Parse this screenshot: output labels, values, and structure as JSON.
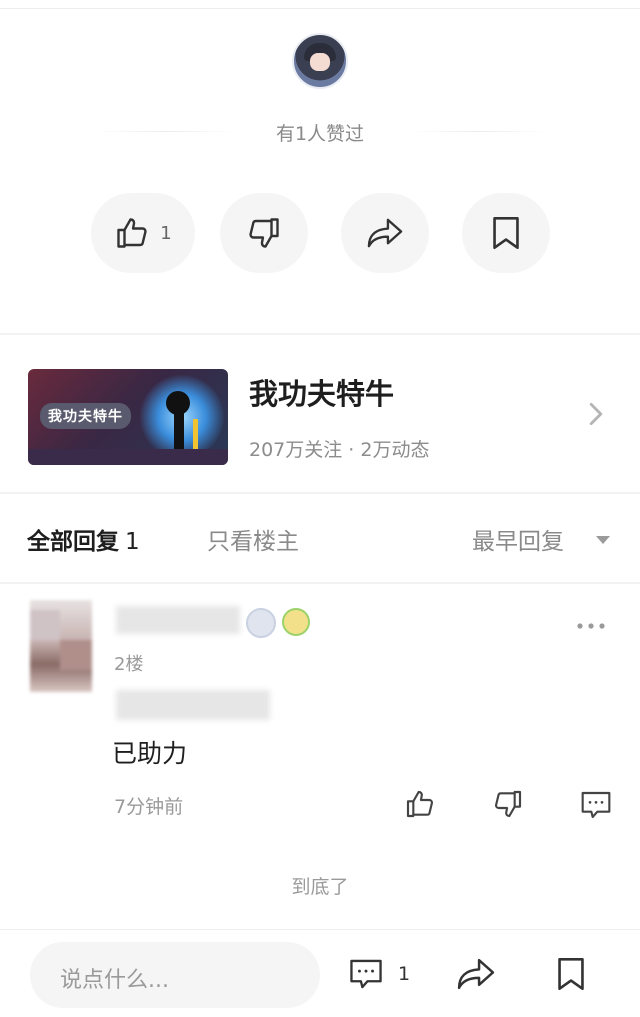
{
  "liked": {
    "text": "有1人赞过"
  },
  "actions": {
    "like_count": "1"
  },
  "forum": {
    "thumb_text": "我功夫特牛",
    "name": "我功夫特牛",
    "stats": "207万关注 · 2万动态"
  },
  "tabs": {
    "all_label": "全部回复",
    "all_count": "1",
    "owner_only": "只看楼主",
    "sort": "最早回复"
  },
  "reply": {
    "floor": "2楼",
    "text": "已助力",
    "time": "7分钟前"
  },
  "end_text": "到底了",
  "bottom_bar": {
    "placeholder": "说点什么...",
    "comment_count": "1"
  }
}
